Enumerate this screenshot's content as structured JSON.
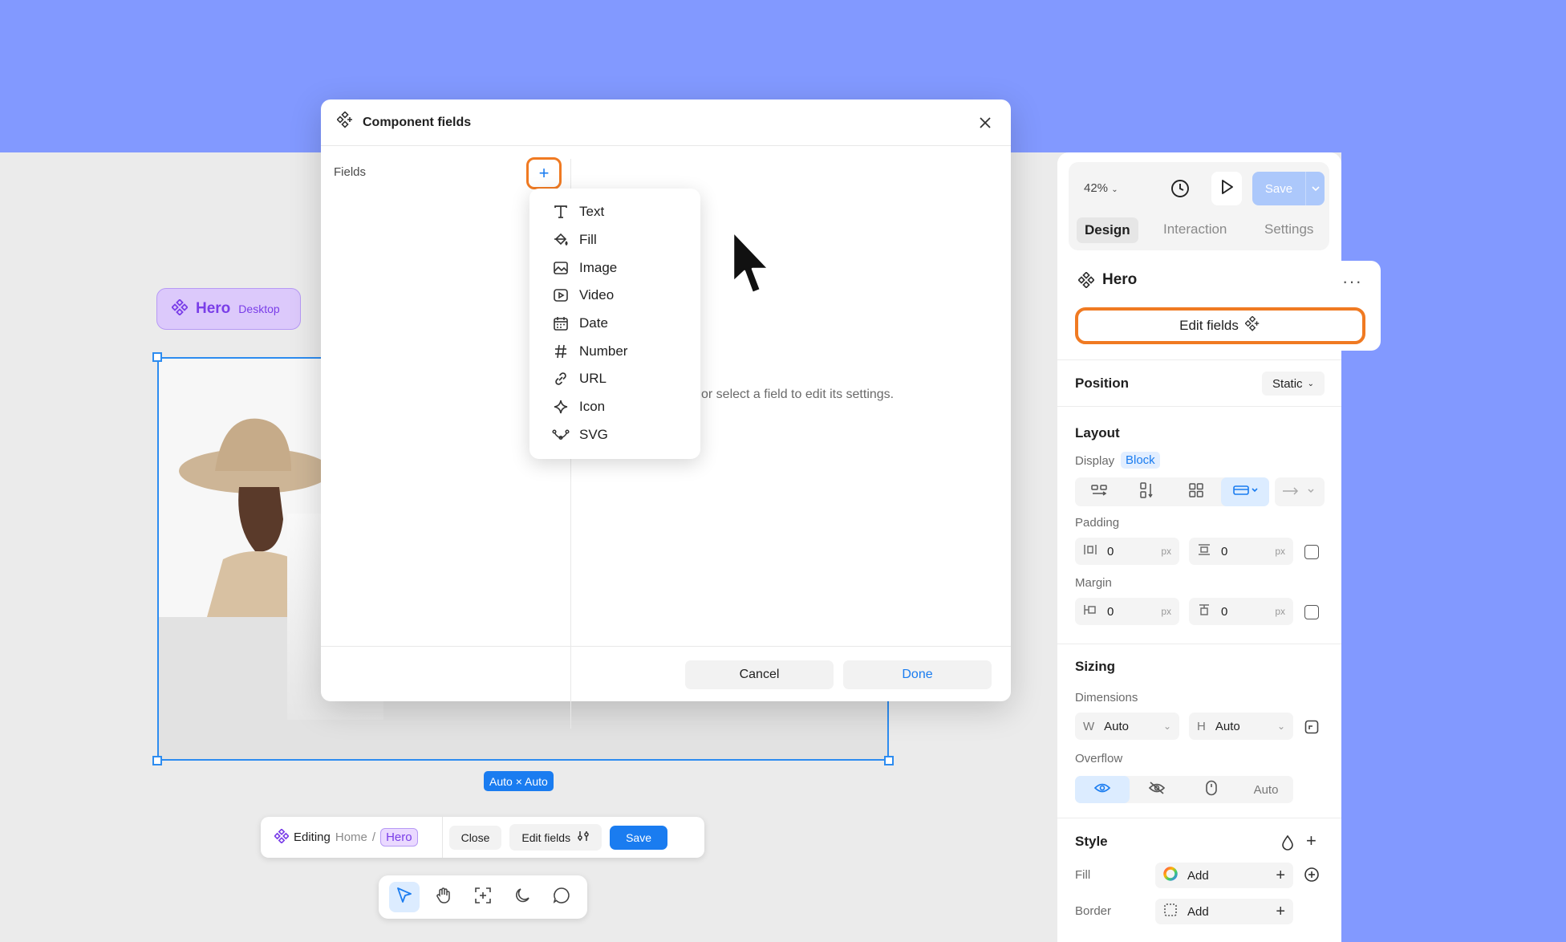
{
  "canvas": {
    "component_pill": {
      "name": "Hero",
      "variant": "Desktop"
    },
    "size_badge": "Auto × Auto"
  },
  "edit_bar": {
    "editing_label": "Editing",
    "crumb_home": "Home",
    "crumb_sep": "/",
    "crumb_current": "Hero",
    "close_label": "Close",
    "edit_fields_label": "Edit fields",
    "save_label": "Save"
  },
  "modal": {
    "title": "Component fields",
    "fields_label": "Fields",
    "add_symbol": "+",
    "hint_text": "or select a field to edit its settings.",
    "cancel_label": "Cancel",
    "done_label": "Done",
    "menu_items": [
      {
        "label": "Text",
        "icon": "text-icon"
      },
      {
        "label": "Fill",
        "icon": "fill-bucket-icon"
      },
      {
        "label": "Image",
        "icon": "image-icon"
      },
      {
        "label": "Video",
        "icon": "video-icon"
      },
      {
        "label": "Date",
        "icon": "calendar-icon"
      },
      {
        "label": "Number",
        "icon": "hash-icon"
      },
      {
        "label": "URL",
        "icon": "link-icon"
      },
      {
        "label": "Icon",
        "icon": "sparkle-icon"
      },
      {
        "label": "SVG",
        "icon": "vector-icon"
      }
    ]
  },
  "panel": {
    "zoom": "42%",
    "save_label": "Save",
    "tabs": [
      "Design",
      "Interaction",
      "Settings"
    ],
    "active_tab": "Design",
    "component_name": "Hero",
    "more": "···",
    "edit_fields_label": "Edit fields",
    "position": {
      "title": "Position",
      "value": "Static"
    },
    "layout": {
      "title": "Layout",
      "display_label": "Display",
      "display_value": "Block",
      "padding_label": "Padding",
      "padding_h": "0",
      "padding_v": "0",
      "margin_label": "Margin",
      "margin_h": "0",
      "margin_v": "0",
      "unit": "px"
    },
    "sizing": {
      "title": "Sizing",
      "dimensions_label": "Dimensions",
      "w_prefix": "W",
      "w_value": "Auto",
      "h_prefix": "H",
      "h_value": "Auto",
      "overflow_label": "Overflow",
      "overflow_auto": "Auto"
    },
    "style": {
      "title": "Style",
      "fill_label": "Fill",
      "fill_value": "Add",
      "border_label": "Border",
      "border_value": "Add"
    }
  },
  "colors": {
    "background": "#8299ff",
    "accent": "#1a7cf0",
    "highlight": "#f07a22",
    "component_purple": "#7a3ee8"
  }
}
